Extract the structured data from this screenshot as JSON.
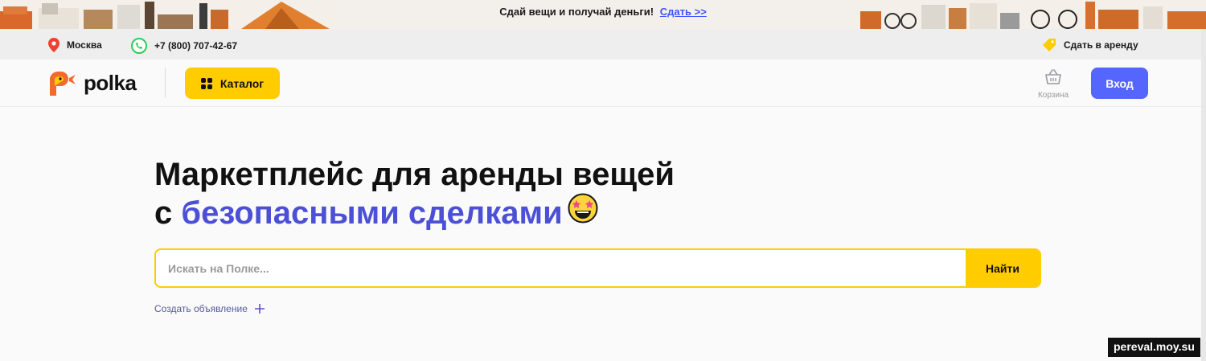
{
  "promo": {
    "text": "Сдай вещи и получай деньги!",
    "link": "Сдать >>"
  },
  "infobar": {
    "city": "Москва",
    "phone": "+7 (800) 707-42-67",
    "rent_out": "Сдать в аренду"
  },
  "header": {
    "logo": "polka",
    "catalog": "Каталог",
    "cart": "Корзина",
    "login": "Вход"
  },
  "hero": {
    "title_line1": "Маркетплейс для аренды вещей",
    "title_line2_prefix": "с",
    "title_line2_accent": "безопасными сделками"
  },
  "search": {
    "placeholder": "Искать на Полке...",
    "value": "",
    "button": "Найти"
  },
  "create_ad": "Создать объявление",
  "watermark": "pereval.moy.su",
  "colors": {
    "accent_yellow": "#ffcc00",
    "accent_blue": "#4b50d6",
    "login_button": "#5566ff",
    "link": "#3f51ff"
  }
}
